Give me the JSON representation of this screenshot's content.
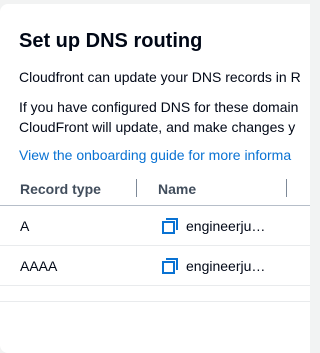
{
  "modal": {
    "title": "Set up DNS routing",
    "paragraph1": "Cloudfront can update your DNS records in R",
    "paragraph2_line1": "If you have configured DNS for these domain",
    "paragraph2_line2": "CloudFront will update, and make changes y",
    "guide_link": "View the onboarding guide for more informa"
  },
  "table": {
    "headers": [
      "Record type",
      "Name"
    ],
    "rows": [
      {
        "type": "A",
        "name": "engineerjunkie.com"
      },
      {
        "type": "AAAA",
        "name": "engineerjunkie.com"
      }
    ]
  },
  "colors": {
    "link": "#0972d3",
    "icon": "#0972d3",
    "header_text": "#414d5c"
  },
  "icons": {
    "copy": "copy-icon"
  }
}
